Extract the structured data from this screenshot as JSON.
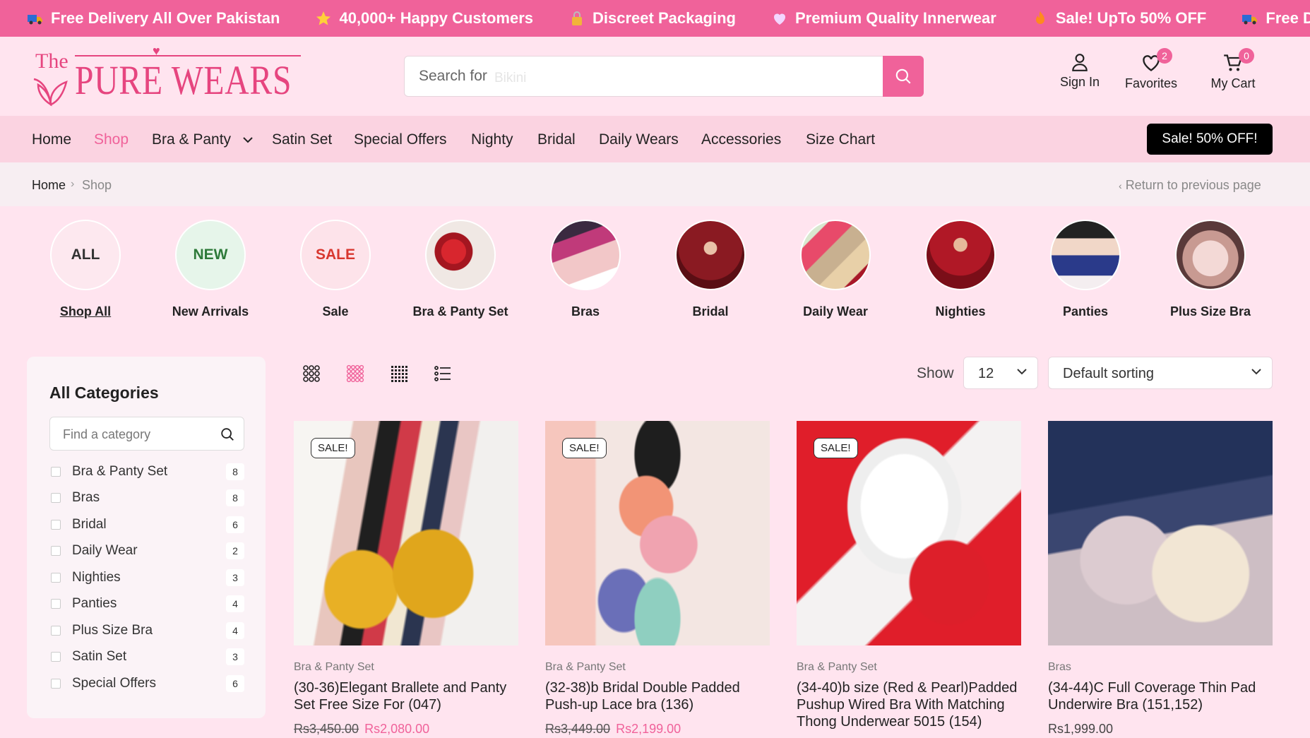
{
  "announcements": [
    {
      "icon": "truck-icon",
      "text": "Free Delivery All Over Pakistan"
    },
    {
      "icon": "star-icon",
      "text": "40,000+ Happy Customers"
    },
    {
      "icon": "lock-icon",
      "text": "Discreet Packaging"
    },
    {
      "icon": "heart-icon",
      "text": "Premium Quality Innerwear"
    },
    {
      "icon": "fire-icon",
      "text": "Sale! UpTo 50% OFF"
    },
    {
      "icon": "truck-icon",
      "text": "Free Deli"
    }
  ],
  "logo": {
    "the": "The",
    "name": "PURE WEARS"
  },
  "search": {
    "placeholder": "Search for",
    "hint": "Bikini"
  },
  "header": {
    "sign_in": "Sign In",
    "favorites": "Favorites",
    "favorites_count": "2",
    "cart": "My Cart",
    "cart_count": "0"
  },
  "nav": {
    "items": [
      "Home",
      "Shop",
      "Bra & Panty",
      "Satin Set",
      "Special Offers",
      "Nighty",
      "Bridal",
      "Daily Wears",
      "Accessories",
      "Size Chart"
    ],
    "active": "Shop",
    "sale_button": "Sale! 50% OFF!"
  },
  "breadcrumb": {
    "home": "Home",
    "separator": "›",
    "current": "Shop",
    "return": "Return to previous page"
  },
  "categories": [
    {
      "badge": "ALL",
      "label": "Shop All"
    },
    {
      "badge": "NEW",
      "label": "New Arrivals"
    },
    {
      "badge": "SALE",
      "label": "Sale"
    },
    {
      "badge": "",
      "label": "Bra & Panty Set"
    },
    {
      "badge": "",
      "label": "Bras"
    },
    {
      "badge": "",
      "label": "Bridal"
    },
    {
      "badge": "",
      "label": "Daily Wear"
    },
    {
      "badge": "",
      "label": "Nighties"
    },
    {
      "badge": "",
      "label": "Panties"
    },
    {
      "badge": "",
      "label": "Plus Size Bra"
    }
  ],
  "sidebar": {
    "title": "All Categories",
    "find_placeholder": "Find a category",
    "items": [
      {
        "name": "Bra & Panty Set",
        "count": "8"
      },
      {
        "name": "Bras",
        "count": "8"
      },
      {
        "name": "Bridal",
        "count": "6"
      },
      {
        "name": "Daily Wear",
        "count": "2"
      },
      {
        "name": "Nighties",
        "count": "3"
      },
      {
        "name": "Panties",
        "count": "4"
      },
      {
        "name": "Plus Size Bra",
        "count": "4"
      },
      {
        "name": "Satin Set",
        "count": "3"
      },
      {
        "name": "Special Offers",
        "count": "6"
      }
    ]
  },
  "toolbar": {
    "show_label": "Show",
    "show_value": "12",
    "sort_value": "Default sorting"
  },
  "products": [
    {
      "badge": "SALE!",
      "category": "Bra & Panty Set",
      "name": "(30-36)Elegant Brallete and Panty Set Free Size For (047)",
      "old_price": "Rs3,450.00",
      "price": "Rs2,080.00"
    },
    {
      "badge": "SALE!",
      "category": "Bra & Panty Set",
      "name": "(32-38)b Bridal Double Padded Push-up Lace bra (136)",
      "old_price": "Rs3,449.00",
      "price": "Rs2,199.00"
    },
    {
      "badge": "SALE!",
      "category": "Bra & Panty Set",
      "name": "(34-40)b size (Red & Pearl)Padded Pushup Wired Bra With Matching Thong Underwear 5015 (154)",
      "old_price": "",
      "price": ""
    },
    {
      "badge": "",
      "category": "Bras",
      "name": "(34-44)C Full Coverage Thin Pad Underwire Bra (151,152)",
      "old_price": "",
      "price": "Rs1,999.00"
    }
  ],
  "colors": {
    "brand_pink": "#f0629a",
    "nav_bg": "#fbd3e1",
    "page_bg": "#ffe4ef"
  }
}
